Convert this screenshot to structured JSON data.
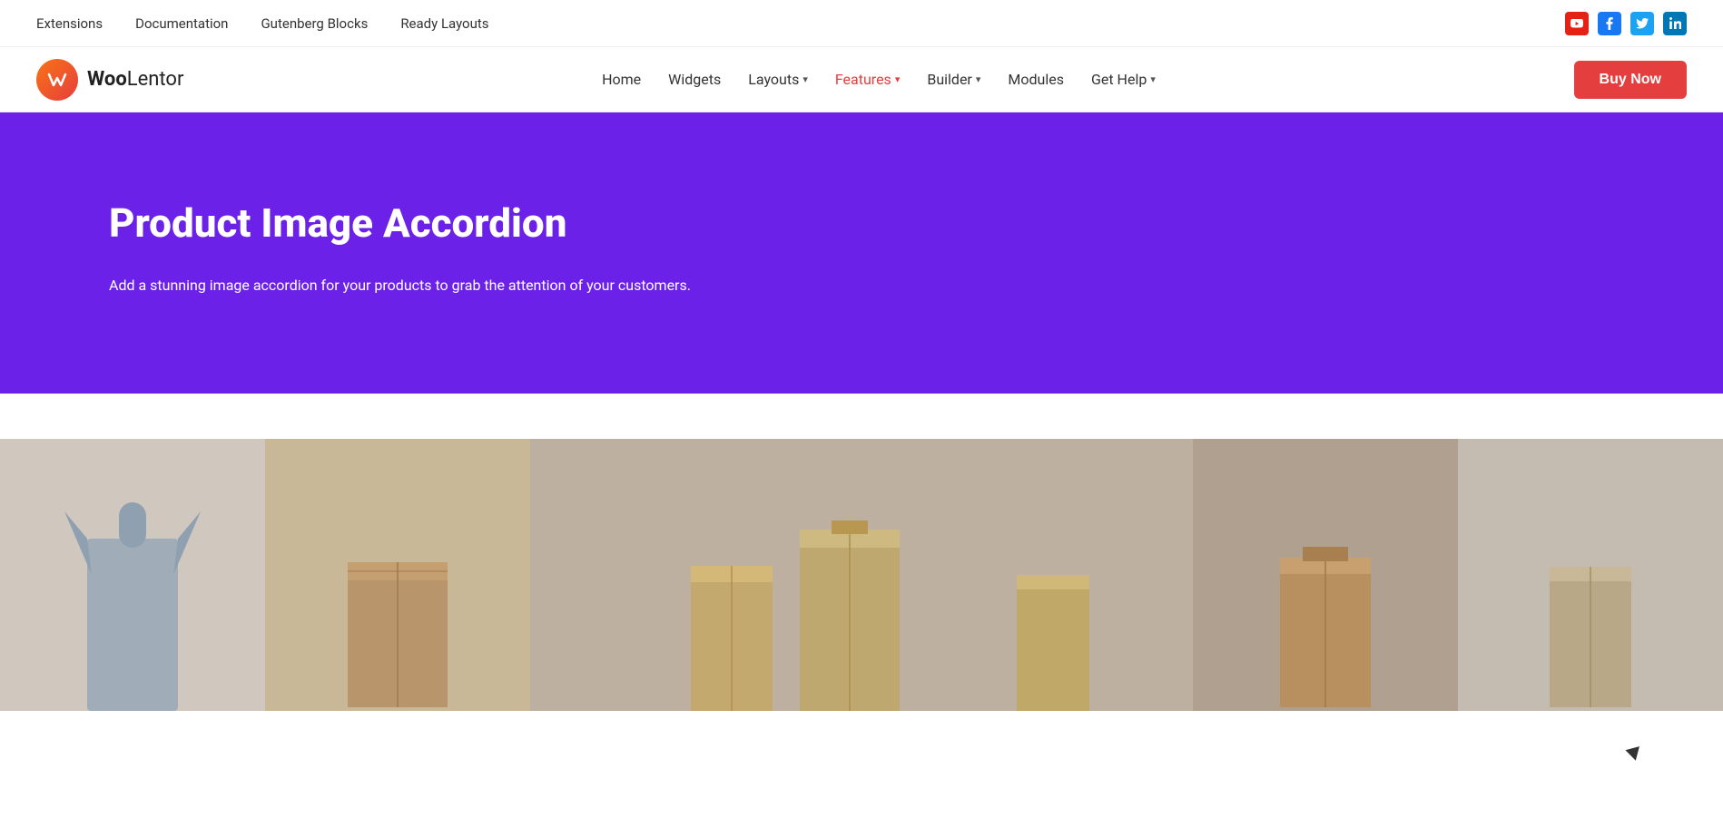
{
  "top_bar": {
    "nav_items": [
      {
        "label": "Extensions",
        "url": "#"
      },
      {
        "label": "Documentation",
        "url": "#"
      },
      {
        "label": "Gutenberg Blocks",
        "url": "#"
      },
      {
        "label": "Ready Layouts",
        "url": "#"
      }
    ],
    "social": [
      {
        "name": "youtube",
        "symbol": "▶",
        "color": "#e62117"
      },
      {
        "name": "facebook",
        "symbol": "f",
        "color": "#1877f2"
      },
      {
        "name": "twitter",
        "symbol": "t",
        "color": "#1da1f2"
      },
      {
        "name": "linkedin",
        "symbol": "in",
        "color": "#0077b5"
      }
    ]
  },
  "main_nav": {
    "logo_initials": "WL",
    "logo_brand_pre": "Woo",
    "logo_brand_post": "Lentor",
    "menu_items": [
      {
        "label": "Home",
        "active": false,
        "has_dropdown": false
      },
      {
        "label": "Widgets",
        "active": false,
        "has_dropdown": false
      },
      {
        "label": "Layouts",
        "active": false,
        "has_dropdown": true
      },
      {
        "label": "Features",
        "active": true,
        "has_dropdown": true
      },
      {
        "label": "Builder",
        "active": false,
        "has_dropdown": true
      },
      {
        "label": "Modules",
        "active": false,
        "has_dropdown": false
      },
      {
        "label": "Get Help",
        "active": false,
        "has_dropdown": true
      }
    ],
    "buy_now_label": "Buy Now"
  },
  "hero": {
    "title": "Product Image Accordion",
    "description": "Add a stunning image accordion for your products to grab the attention of your customers.",
    "bg_color": "#6B21E8"
  },
  "content": {
    "section_bg": "#ffffff"
  }
}
